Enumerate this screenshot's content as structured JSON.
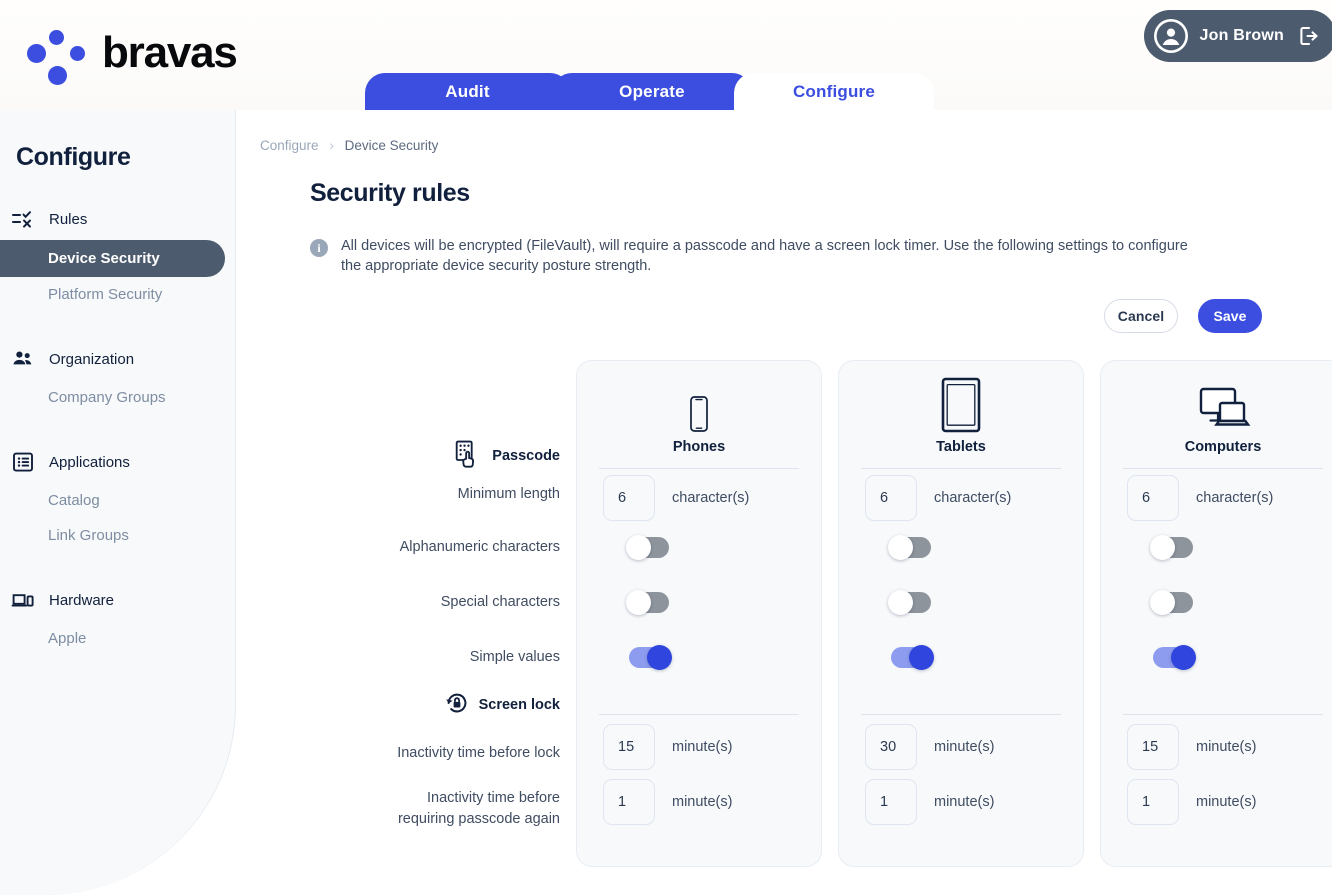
{
  "brand": {
    "name": "bravas"
  },
  "user": {
    "name": "Jon Brown",
    "avatar_icon": "user-circle-icon",
    "logout_icon": "logout-icon"
  },
  "nav_tabs": [
    {
      "label": "Audit",
      "active": false
    },
    {
      "label": "Operate",
      "active": false
    },
    {
      "label": "Configure",
      "active": true
    }
  ],
  "sidebar": {
    "title": "Configure",
    "groups": [
      {
        "label": "Rules",
        "icon": "rules-checklist-icon",
        "items": [
          {
            "label": "Device Security",
            "active": true
          },
          {
            "label": "Platform Security",
            "active": false
          }
        ]
      },
      {
        "label": "Organization",
        "icon": "people-icon",
        "items": [
          {
            "label": "Company Groups",
            "active": false
          }
        ]
      },
      {
        "label": "Applications",
        "icon": "list-box-icon",
        "items": [
          {
            "label": "Catalog",
            "active": false
          },
          {
            "label": "Link Groups",
            "active": false
          }
        ]
      },
      {
        "label": "Hardware",
        "icon": "devices-icon",
        "items": [
          {
            "label": "Apple",
            "active": false
          }
        ]
      }
    ]
  },
  "breadcrumb": {
    "root": "Configure",
    "separator": "›",
    "current": "Device Security"
  },
  "page": {
    "title": "Security rules",
    "info_icon": "info-icon",
    "info_text": "All devices will be encrypted (FileVault), will require a passcode and have a screen lock timer. Use the following settings to configure the appropriate device security posture strength."
  },
  "actions": {
    "cancel_label": "Cancel",
    "save_label": "Save"
  },
  "columns": [
    {
      "name": "Phones",
      "icon": "phone-icon"
    },
    {
      "name": "Tablets",
      "icon": "tablet-icon"
    },
    {
      "name": "Computers",
      "icon": "computers-icon"
    }
  ],
  "sections": [
    {
      "title": "Passcode",
      "icon": "keypad-hand-icon"
    },
    {
      "title": "Screen lock",
      "icon": "lock-refresh-icon"
    }
  ],
  "rows": {
    "minimum_length": {
      "label": "Minimum length",
      "unit": "character(s)",
      "values": {
        "phones": "6",
        "tablets": "6",
        "computers": "6"
      }
    },
    "alphanumeric": {
      "label": "Alphanumeric characters",
      "values": {
        "phones": false,
        "tablets": false,
        "computers": false
      }
    },
    "special": {
      "label": "Special characters",
      "values": {
        "phones": false,
        "tablets": false,
        "computers": false
      }
    },
    "simple_values": {
      "label": "Simple values",
      "values": {
        "phones": true,
        "tablets": true,
        "computers": true
      }
    },
    "inactivity_lock": {
      "label": "Inactivity time before lock",
      "unit": "minute(s)",
      "values": {
        "phones": "15",
        "tablets": "30",
        "computers": "15"
      }
    },
    "inactivity_passcode": {
      "label_line1": "Inactivity time before",
      "label_line2": "requiring passcode again",
      "unit": "minute(s)",
      "values": {
        "phones": "1",
        "tablets": "1",
        "computers": "1"
      }
    }
  },
  "colors": {
    "accent": "#3b4ee0",
    "slate": "#4d5b6e",
    "ink": "#11203c",
    "card_bg": "#f7f9fb"
  }
}
